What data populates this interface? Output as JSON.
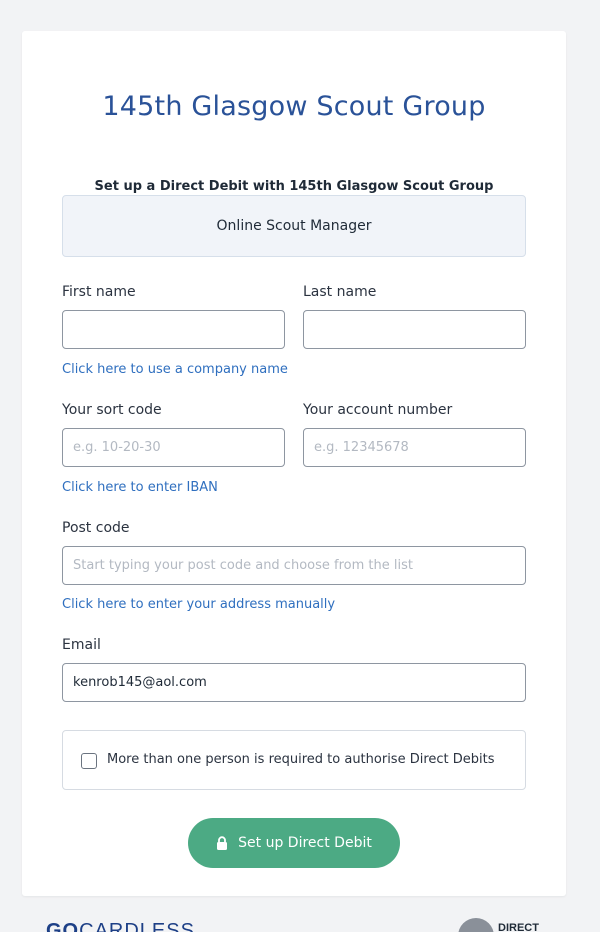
{
  "header": {
    "group_name": "145th Glasgow Scout Group",
    "setup_heading": "Set up a Direct Debit with 145th Glasgow Scout Group",
    "organisation": "Online Scout Manager"
  },
  "form": {
    "first_name": {
      "label": "First name",
      "value": "",
      "placeholder": ""
    },
    "last_name": {
      "label": "Last name",
      "value": "",
      "placeholder": ""
    },
    "company_link": "Click here to use a company name",
    "sort_code": {
      "label": "Your sort code",
      "value": "",
      "placeholder": "e.g. 10-20-30"
    },
    "account_number": {
      "label": "Your account number",
      "value": "",
      "placeholder": "e.g. 12345678"
    },
    "iban_link": "Click here to enter IBAN",
    "post_code": {
      "label": "Post code",
      "value": "",
      "placeholder": "Start typing your post code and choose from the list"
    },
    "address_link": "Click here to enter your address manually",
    "email": {
      "label": "Email",
      "value": "kenrob145@aol.com",
      "placeholder": ""
    },
    "multi_authorise": {
      "label": "More than one person is required to authorise Direct Debits",
      "checked": false
    },
    "submit_label": "Set up Direct Debit"
  },
  "footer": {
    "left_logo_text_bold": "GO",
    "left_logo_text": "CARDLESS",
    "right_logo_text": "DIRECT"
  },
  "colors": {
    "title": "#2a5298",
    "link": "#2f6fbf",
    "button": "#4caa84"
  },
  "icons": {
    "submit": "lock-icon",
    "footer_right": "direct-debit-logo"
  }
}
